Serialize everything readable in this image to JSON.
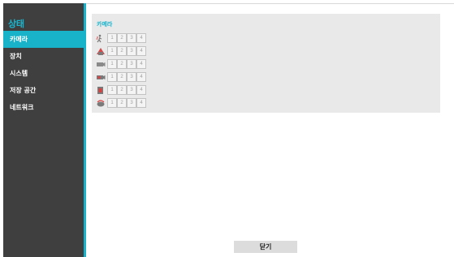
{
  "sidebar": {
    "title": "상태",
    "items": [
      {
        "label": "카메라",
        "active": true
      },
      {
        "label": "장치",
        "active": false
      },
      {
        "label": "시스템",
        "active": false
      },
      {
        "label": "저장 공간",
        "active": false
      },
      {
        "label": "네트워크",
        "active": false
      }
    ]
  },
  "main": {
    "section_title": "카메라",
    "rows": [
      {
        "icon": "motion-icon",
        "cells": [
          "1",
          "2",
          "3",
          "4"
        ]
      },
      {
        "icon": "tampering-icon",
        "cells": [
          "1",
          "2",
          "3",
          "4"
        ]
      },
      {
        "icon": "video-loss-icon",
        "cells": [
          "1",
          "2",
          "3",
          "4"
        ]
      },
      {
        "icon": "recording-icon",
        "cells": [
          "1",
          "2",
          "3",
          "4"
        ]
      },
      {
        "icon": "alarm-icon",
        "cells": [
          "1",
          "2",
          "3",
          "4"
        ]
      },
      {
        "icon": "audio-icon",
        "cells": [
          "1",
          "2",
          "3",
          "4"
        ]
      }
    ]
  },
  "footer": {
    "close_label": "닫기"
  },
  "colors": {
    "accent": "#16b3cc",
    "sidebar_bg": "#3f3f3f",
    "panel_bg": "#e9e9e9"
  }
}
